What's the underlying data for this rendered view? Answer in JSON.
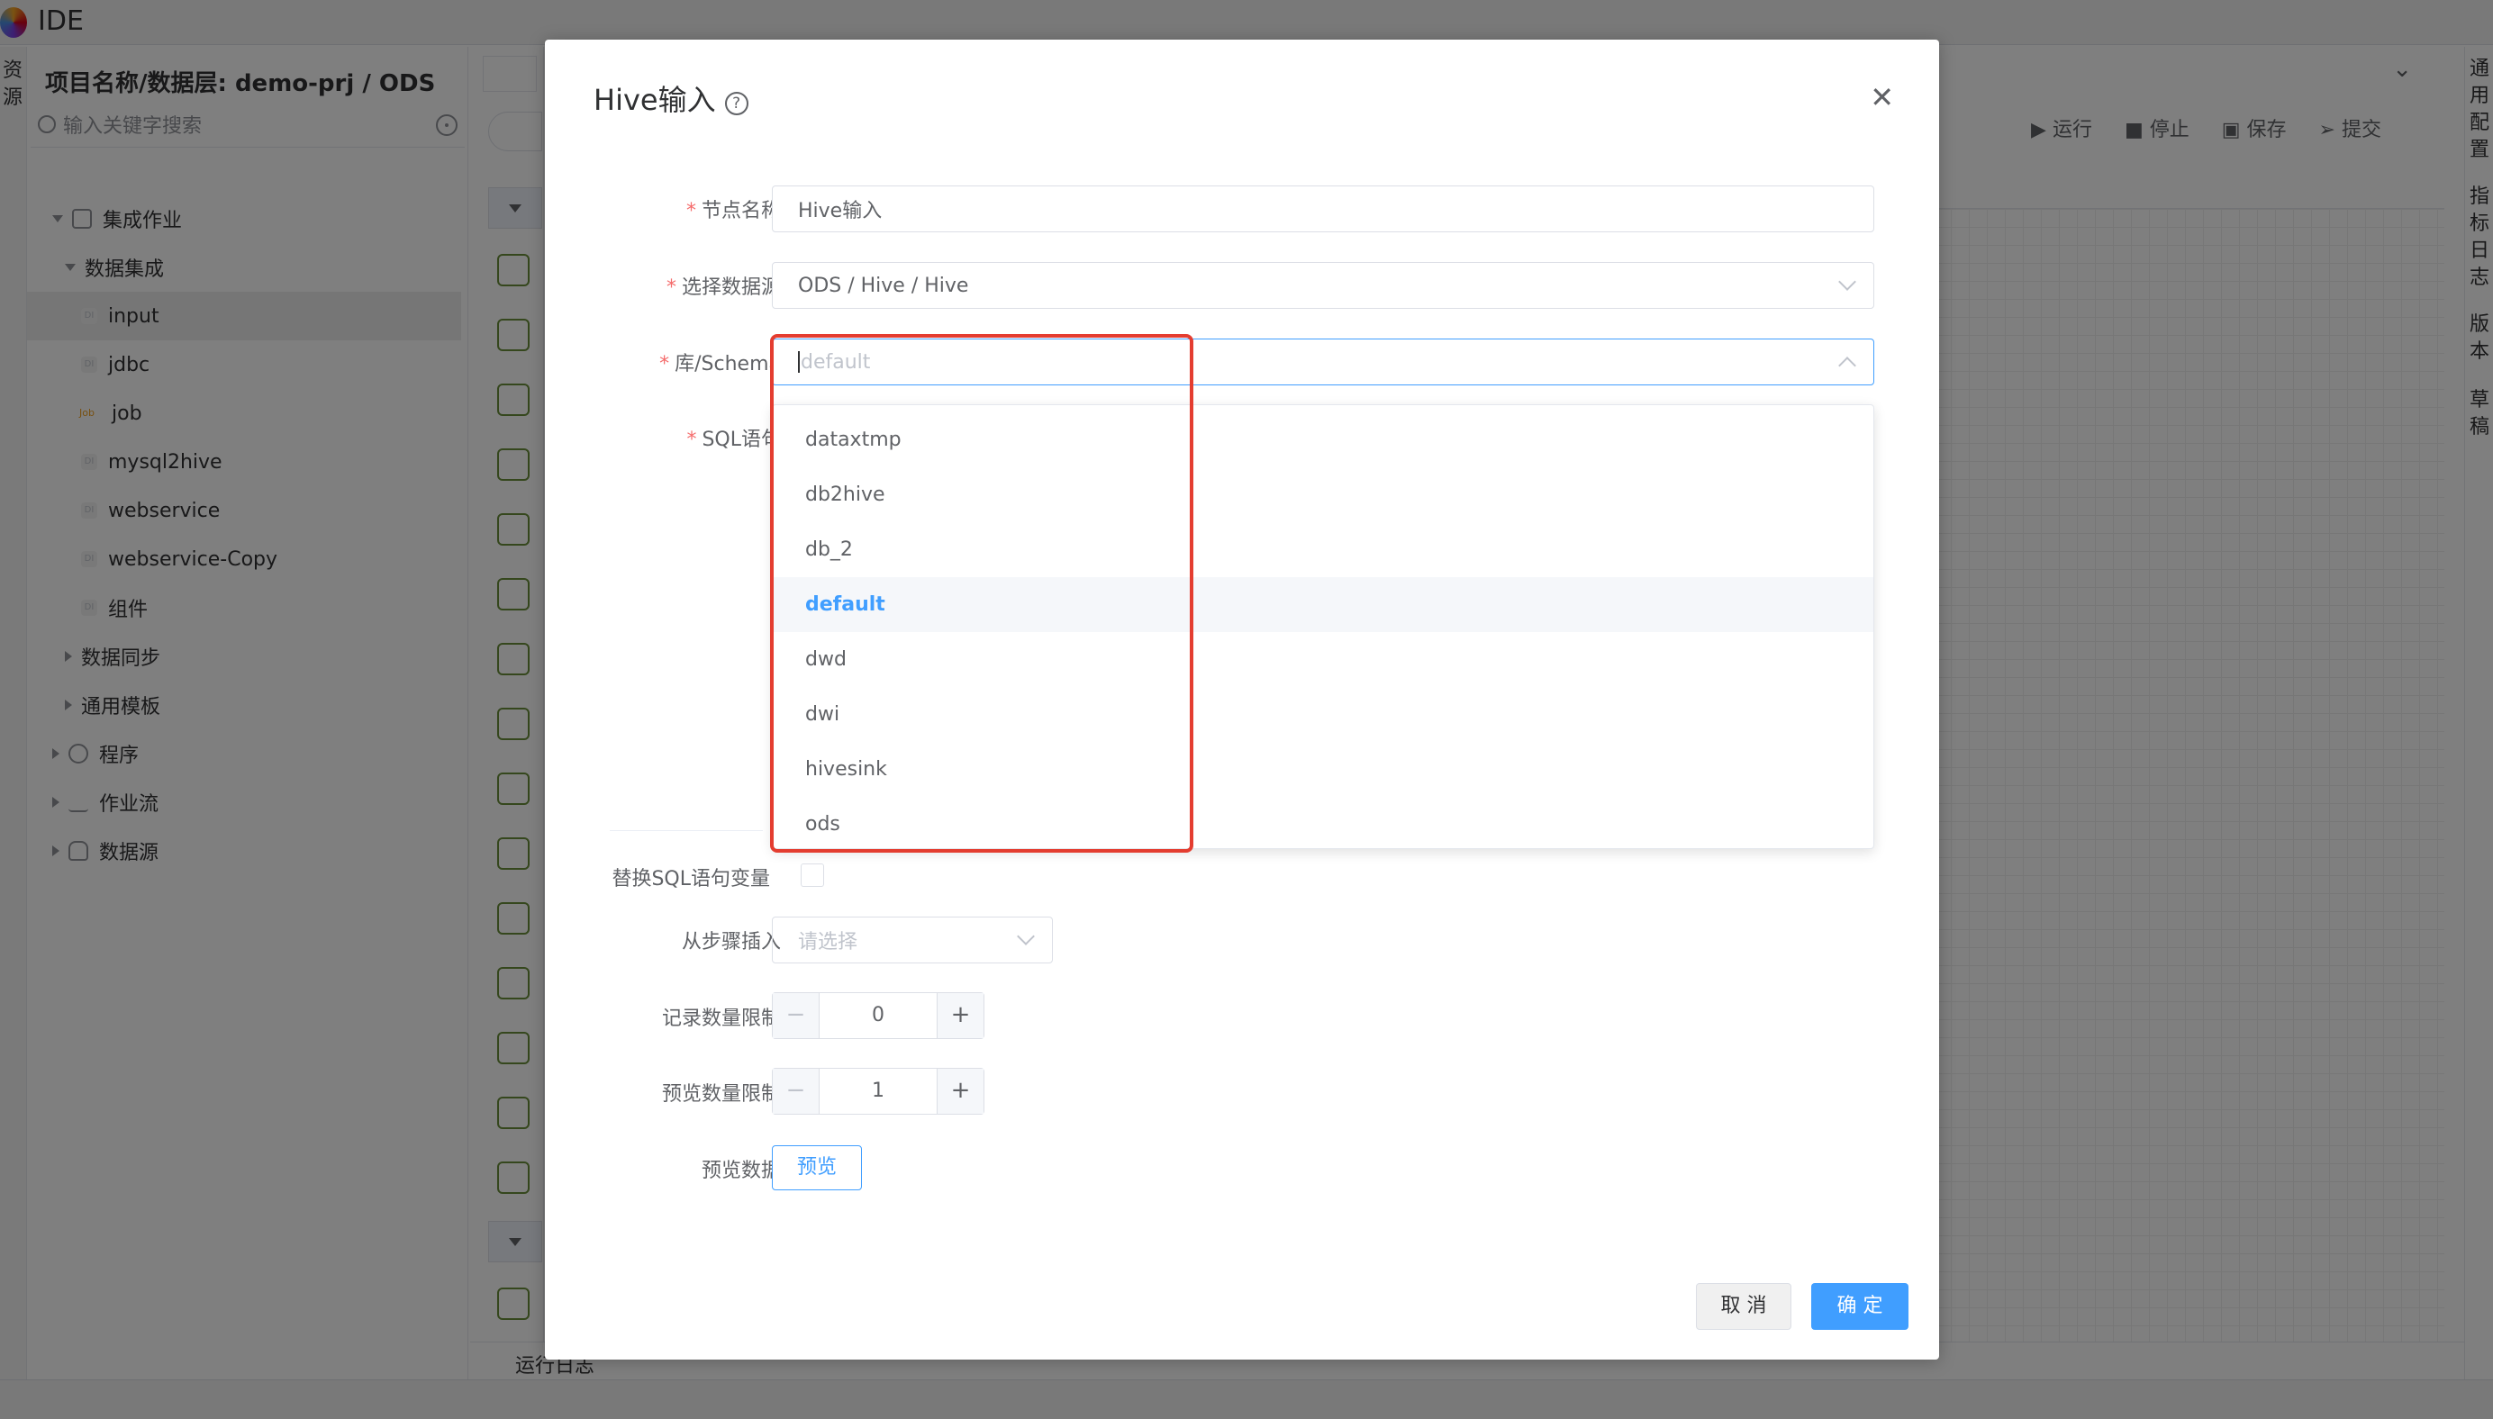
{
  "app": {
    "title": "IDE",
    "left_strip_label": "资源",
    "project_label": "项目名称/数据层:  demo-prj / ODS"
  },
  "sidebar": {
    "search_placeholder": "输入关键字搜索",
    "tree": [
      {
        "label": "集成作业",
        "level": 1,
        "expanded": true
      },
      {
        "label": "数据集成",
        "level": 2,
        "expanded": true
      },
      {
        "label": "input",
        "level": 3,
        "selected": true
      },
      {
        "label": "jdbc",
        "level": 3
      },
      {
        "label": "job",
        "level": 3
      },
      {
        "label": "mysql2hive",
        "level": 3
      },
      {
        "label": "webservice",
        "level": 3
      },
      {
        "label": "webservice-Copy",
        "level": 3
      },
      {
        "label": "组件",
        "level": 3
      },
      {
        "label": "数据同步",
        "level": 2
      },
      {
        "label": "通用模板",
        "level": 2
      },
      {
        "label": "程序",
        "level": 1
      },
      {
        "label": "作业流",
        "level": 1
      },
      {
        "label": "数据源",
        "level": 1
      }
    ]
  },
  "toolbar": {
    "run": "运行",
    "stop": "停止",
    "save": "保存",
    "submit": "提交"
  },
  "right_strip": {
    "general_config": "通用配置",
    "metric_log": "指标日志",
    "version": "版本",
    "draft": "草稿"
  },
  "log_bar": {
    "label": "运行日志"
  },
  "dialog": {
    "title": "Hive输入",
    "fields": {
      "node_name": {
        "label": "节点名称",
        "value": "Hive输入"
      },
      "datasource": {
        "label": "选择数据源",
        "value": "ODS / Hive / Hive"
      },
      "schema": {
        "label": "库/Schema",
        "placeholder": "default",
        "options": [
          "dataxtmp",
          "db2hive",
          "db_2",
          "default",
          "dwd",
          "dwi",
          "hivesink",
          "ods"
        ],
        "selected": "default"
      },
      "sql": {
        "label": "SQL语句"
      },
      "replace_vars": {
        "label": "替换SQL语句变量",
        "checked": false
      },
      "insert_from_step": {
        "label": "从步骤插入",
        "placeholder": "请选择"
      },
      "record_limit": {
        "label": "记录数量限制",
        "value": "0"
      },
      "preview_limit": {
        "label": "预览数量限制",
        "value": "1"
      },
      "preview_data": {
        "label": "预览数据",
        "button": "预览"
      }
    },
    "footer": {
      "cancel": "取 消",
      "ok": "确 定"
    }
  }
}
